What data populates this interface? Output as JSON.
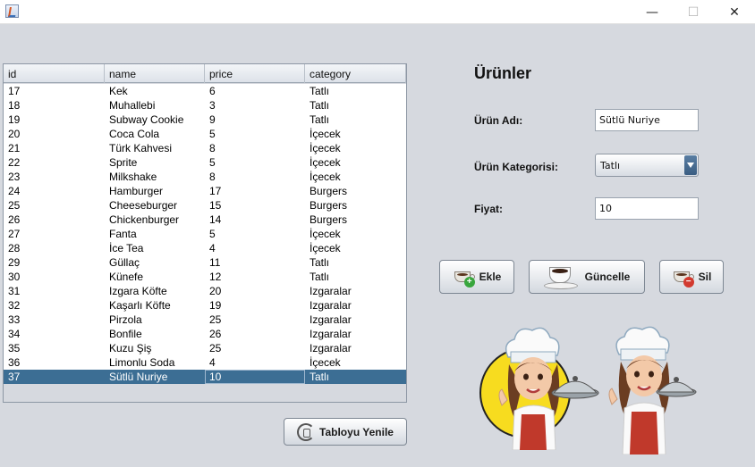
{
  "window": {
    "minimize_glyph": "—",
    "maximize_glyph": "☐",
    "close_glyph": "✕"
  },
  "table": {
    "columns": [
      "id",
      "name",
      "price",
      "category"
    ],
    "rows": [
      [
        "17",
        "Kek",
        "6",
        "Tatlı"
      ],
      [
        "18",
        "Muhallebi",
        "3",
        "Tatlı"
      ],
      [
        "19",
        "Subway Cookie",
        "9",
        "Tatlı"
      ],
      [
        "20",
        "Coca Cola",
        "5",
        "İçecek"
      ],
      [
        "21",
        "Türk Kahvesi",
        "8",
        "İçecek"
      ],
      [
        "22",
        "Sprite",
        "5",
        "İçecek"
      ],
      [
        "23",
        "Milkshake",
        "8",
        "İçecek"
      ],
      [
        "24",
        "Hamburger",
        "17",
        "Burgers"
      ],
      [
        "25",
        "Cheeseburger",
        "15",
        "Burgers"
      ],
      [
        "26",
        "Chickenburger",
        "14",
        "Burgers"
      ],
      [
        "27",
        "Fanta",
        "5",
        "İçecek"
      ],
      [
        "28",
        "İce Tea",
        "4",
        "İçecek"
      ],
      [
        "29",
        "Güllaç",
        "11",
        "Tatlı"
      ],
      [
        "30",
        "Künefe",
        "12",
        "Tatlı"
      ],
      [
        "31",
        "Izgara Köfte",
        "20",
        "Izgaralar"
      ],
      [
        "32",
        "Kaşarlı Köfte",
        "19",
        "Izgaralar"
      ],
      [
        "33",
        "Pirzola",
        "25",
        "Izgaralar"
      ],
      [
        "34",
        "Bonfile",
        "26",
        "Izgaralar"
      ],
      [
        "35",
        "Kuzu Şiş",
        "25",
        "Izgaralar"
      ],
      [
        "36",
        "Limonlu Soda",
        "4",
        "İçecek"
      ],
      [
        "37",
        "Sütlü Nuriye",
        "10",
        "Tatlı"
      ]
    ],
    "selected_row_index": 20,
    "focused_column_index": 2
  },
  "refresh_button": {
    "label": "Tabloyu Yenile",
    "icon": "refresh-database-icon"
  },
  "form": {
    "title": "Ürünler",
    "name_label": "Ürün Adı:",
    "name_value": "Sütlü Nuriye",
    "category_label": "Ürün Kategorisi:",
    "category_value": "Tatlı",
    "price_label": "Fiyat:",
    "price_value": "10"
  },
  "actions": {
    "add_label": "Ekle",
    "update_label": "Güncelle",
    "delete_label": "Sil"
  },
  "colors": {
    "selected_row": "#3c6e94",
    "background": "#d6d9df"
  }
}
